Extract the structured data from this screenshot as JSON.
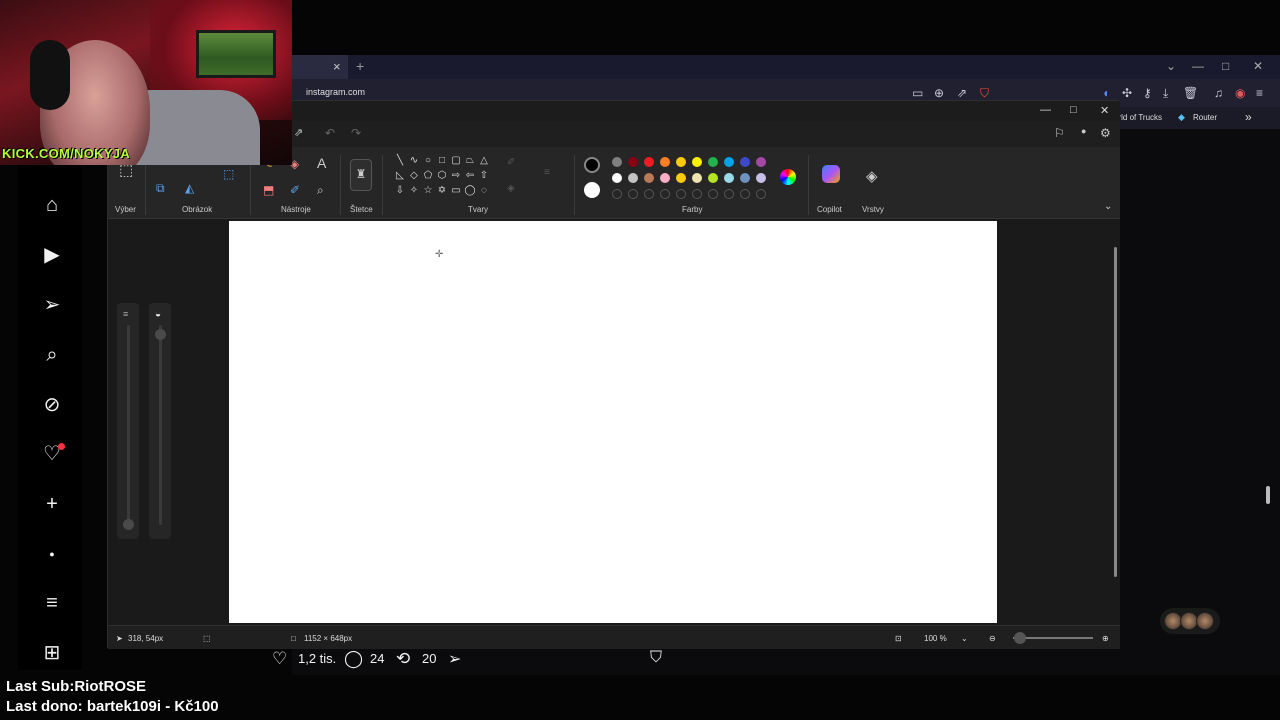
{
  "webcam": {
    "channel_text": "KICK.COM/NOKYJA"
  },
  "browser": {
    "tab_close": "×",
    "new_tab": "+",
    "url": "instagram.com",
    "bookmarks": [
      {
        "label": "orld of Trucks"
      },
      {
        "label": "Router"
      }
    ],
    "bookmarks_more": "»"
  },
  "paint": {
    "ribbon_labels": {
      "selection": "Výber",
      "image": "Obrázok",
      "tools": "Nástroje",
      "brushes": "Štetce",
      "shapes": "Tvary",
      "colors": "Farby",
      "copilot": "Copilot",
      "layers": "Vrstvy"
    },
    "colors": {
      "primary": "#000000",
      "secondary": "#ffffff",
      "row1": [
        "#000000",
        "#7f7f7f",
        "#880015",
        "#ed1c24",
        "#ff7f27",
        "#ffc90e",
        "#fff200",
        "#22b14c",
        "#00a2e8",
        "#3f48cc",
        "#a349a4"
      ],
      "row2": [
        "#ffffff",
        "#c3c3c3",
        "#b97a57",
        "#ffaec9",
        "#ffc90e",
        "#efe4b0",
        "#b5e61d",
        "#99d9ea",
        "#7092be",
        "#c8bfe7"
      ]
    },
    "status": {
      "cursor_pos": "318, 54px",
      "canvas_size": "1152 × 648px",
      "zoom": "100 %"
    }
  },
  "post": {
    "likes": "1,2 tis.",
    "comments": "24",
    "reposts": "20"
  },
  "overlay": {
    "last_sub": "Last Sub:RiotROSE",
    "last_dono": "Last dono: bartek109i - Kč100"
  }
}
